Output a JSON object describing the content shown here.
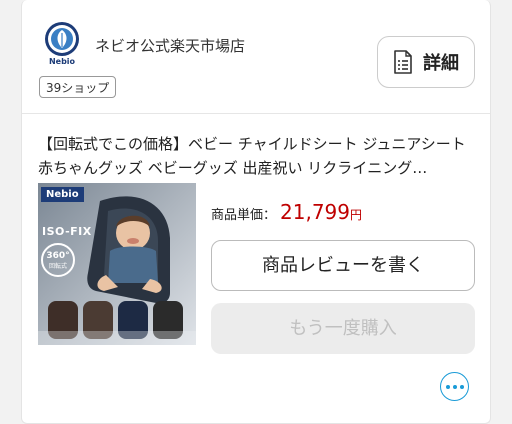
{
  "shop": {
    "logo_text": "Nebio",
    "name": "ネビオ公式楽天市場店",
    "tag": "39ショップ",
    "detail_label": "詳細"
  },
  "product": {
    "title": "【回転式でこの価格】ベビー チャイルドシート ジュニアシート 赤ちゃんグッズ ベビーグッズ 出産祝い リクライニング…",
    "image_badges": {
      "brand": "Nebio",
      "isofix": "ISO-FIX",
      "rotation": "360°",
      "rotation_sub": "回転式"
    },
    "price_label": "商品単価：",
    "price_value": "21,799",
    "price_unit": "円"
  },
  "actions": {
    "review_label": "商品レビューを書く",
    "buy_again_label": "もう一度購入",
    "more_icon": "more-horizontal-icon"
  },
  "colors": {
    "price": "#bf0000",
    "accent": "#1a9bd7",
    "disabled_bg": "#ececec"
  }
}
